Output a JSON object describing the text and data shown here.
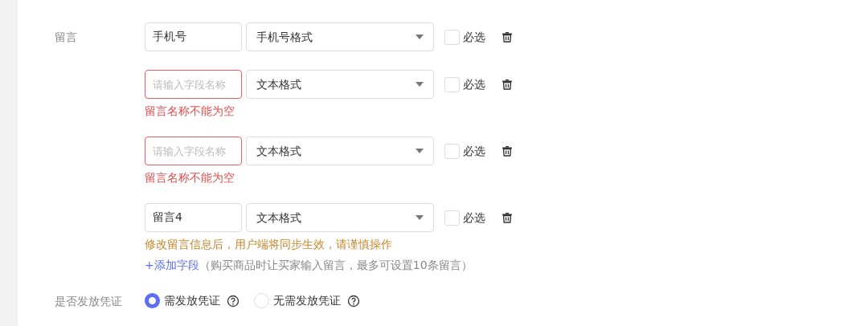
{
  "message_section": {
    "label": "留言",
    "fields": [
      {
        "name": "手机号",
        "invalid": false,
        "format": "手机号格式",
        "required_label": "必选",
        "required": false
      },
      {
        "placeholder": "请输入字段名称",
        "invalid": true,
        "format": "文本格式",
        "required_label": "必选",
        "required": false,
        "note": {
          "kind": "error",
          "text": "留言名称不能为空"
        }
      },
      {
        "placeholder": "请输入字段名称",
        "invalid": true,
        "format": "文本格式",
        "required_label": "必选",
        "required": false,
        "note": {
          "kind": "error",
          "text": "留言名称不能为空"
        }
      },
      {
        "name": "留言4",
        "invalid": false,
        "format": "文本格式",
        "required_label": "必选",
        "required": false,
        "note": {
          "kind": "warning",
          "text": "修改留言信息后，用户端将同步生效，请谨慎操作"
        }
      }
    ],
    "add_link": "+添加字段",
    "add_hint": "（购买商品时让买家输入留言，最多可设置10条留言）"
  },
  "voucher_section": {
    "label": "是否发放凭证",
    "options": [
      {
        "label": "需发放凭证",
        "selected": true
      },
      {
        "label": "无需发放凭证",
        "selected": false
      }
    ]
  }
}
